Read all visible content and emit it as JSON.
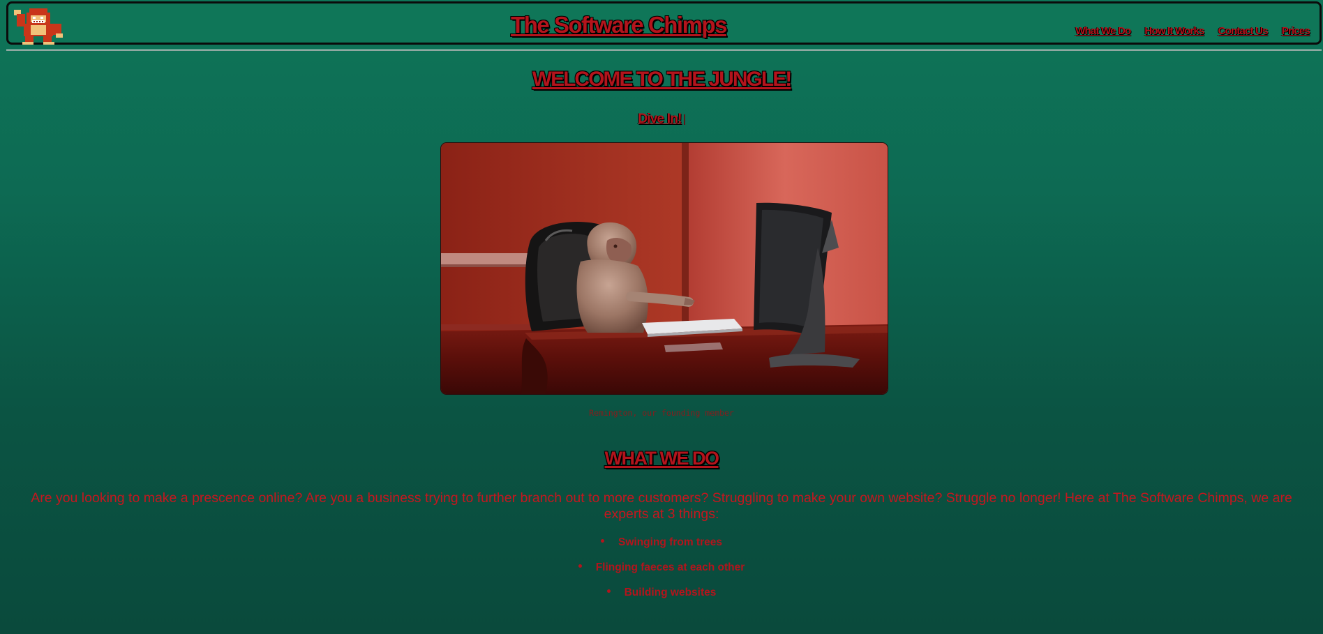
{
  "header": {
    "logo_icon": "pixel-gorilla-logo",
    "title": "The Software Chimps",
    "nav": [
      {
        "label": "What We Do"
      },
      {
        "label": "How It Works"
      },
      {
        "label": "Contact Us"
      },
      {
        "label": "Prices"
      }
    ]
  },
  "hero": {
    "heading": "WELCOME TO THE JUNGLE!",
    "cta_label": "Dive In!",
    "image_icon": "baboon-at-computer-photo",
    "caption": "Remington, our founding member"
  },
  "what_we_do": {
    "heading": "WHAT WE DO",
    "intro": "Are you looking to make a prescence online? Are you a business trying to further branch out to more customers? Struggling to make your own website? Struggle no longer! Here at The Software Chimps, we are experts at 3 things:",
    "items": [
      {
        "label": "Swinging from trees"
      },
      {
        "label": "Flinging faeces at each other"
      },
      {
        "label": "Building websites"
      }
    ]
  },
  "colors": {
    "accent_red": "#b3141c",
    "background_green": "#0e7558",
    "header_bg": "#0f7658"
  }
}
